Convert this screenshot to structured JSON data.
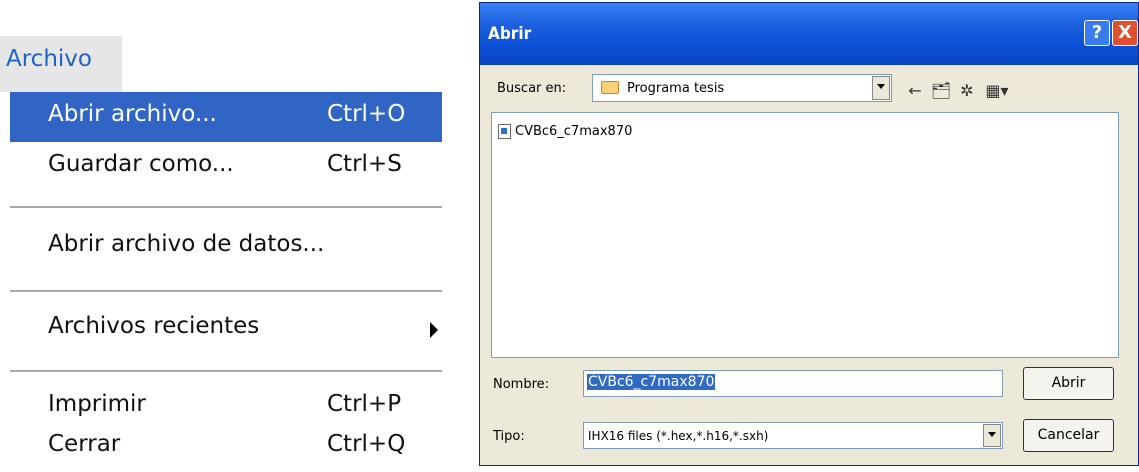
{
  "menu": {
    "title": "Archivo",
    "items": [
      {
        "label": "Abrir archivo...",
        "shortcut": "Ctrl+O"
      },
      {
        "label": "Guardar como...",
        "shortcut": "Ctrl+S"
      },
      {
        "label": "Abrir archivo de datos...",
        "shortcut": ""
      },
      {
        "label": "Archivos recientes",
        "shortcut": ""
      },
      {
        "label": "Imprimir",
        "shortcut": "Ctrl+P"
      },
      {
        "label": "Cerrar",
        "shortcut": "Ctrl+Q"
      }
    ],
    "selected_index": 0,
    "accent_color": "#3165c5",
    "title_color": "#1e63c4"
  },
  "dialog": {
    "title": "Abrir",
    "help_glyph": "?",
    "close_glyph": "X",
    "look_in_label": "Buscar en:",
    "look_in_value": "Programa tesis",
    "toolbar_icons": [
      "back-arrow-icon",
      "up-folder-icon",
      "new-folder-icon",
      "view-menu-icon"
    ],
    "files": [
      {
        "name": "CVBc6_c7max870"
      }
    ],
    "filename_label": "Nombre:",
    "filename_value": "CVBc6_c7max870",
    "filetype_label": "Tipo:",
    "filetype_value": "IHX16 files (*.hex,*.h16,*.sxh)",
    "open_button": "Abrir",
    "cancel_button": "Cancelar",
    "titlebar_color": "#0b4fd6"
  }
}
